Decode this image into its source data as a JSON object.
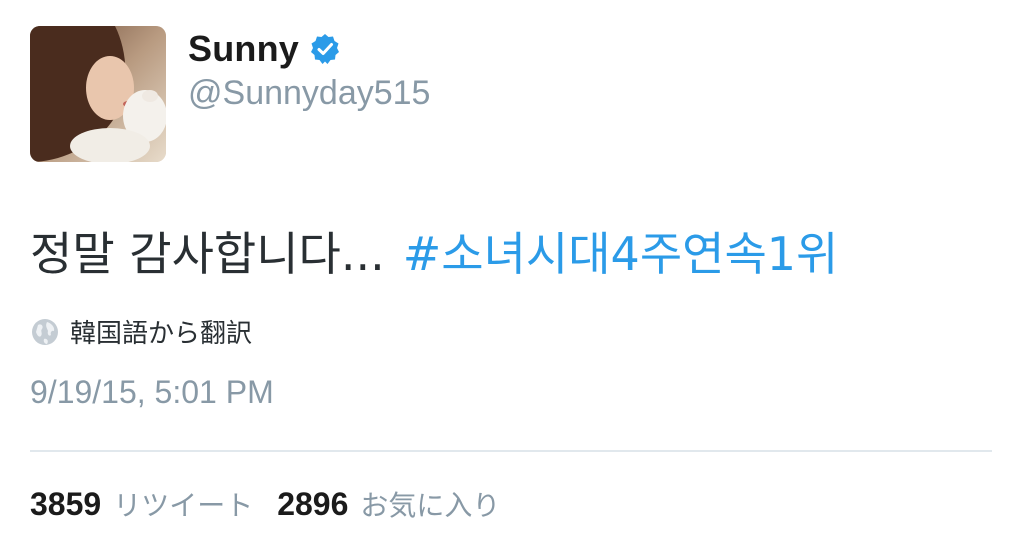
{
  "user": {
    "display_name": "Sunny",
    "handle": "@Sunnyday515",
    "verified": true,
    "avatar_icon": "profile-photo"
  },
  "tweet": {
    "text": "정말 감사합니다...",
    "hashtag": "#소녀시대4주연속1위",
    "translate_label": "韓国語から翻訳",
    "timestamp": "9/19/15, 5:01 PM"
  },
  "stats": {
    "retweets_count": "3859",
    "retweets_label": "リツイート",
    "favorites_count": "2896",
    "favorites_label": "お気に入り"
  },
  "colors": {
    "link": "#2b9be8",
    "verified": "#2b9be8",
    "secondary_text": "#8899a6"
  }
}
